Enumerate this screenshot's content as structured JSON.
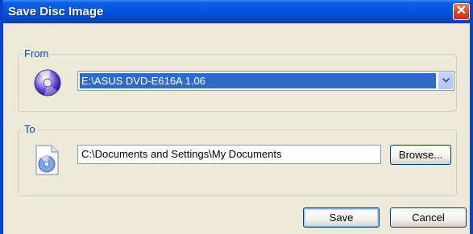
{
  "window": {
    "title": "Save Disc Image",
    "close_label": "✕"
  },
  "from_group": {
    "label": "From",
    "icon": "cd-disc-icon",
    "drive_select": {
      "selected": "E:\\ASUS DVD-E616A 1.06"
    }
  },
  "to_group": {
    "label": "To",
    "icon": "disc-image-file-icon",
    "path_input": {
      "value": "C:\\Documents and Settings\\My Documents"
    },
    "browse_label": "Browse..."
  },
  "buttons": {
    "save_label": "Save",
    "cancel_label": "Cancel"
  },
  "colors": {
    "titlebar": "#0656e1",
    "selection": "#316ac5",
    "group_label": "#0046d5",
    "dialog_bg": "#ece9d8"
  }
}
